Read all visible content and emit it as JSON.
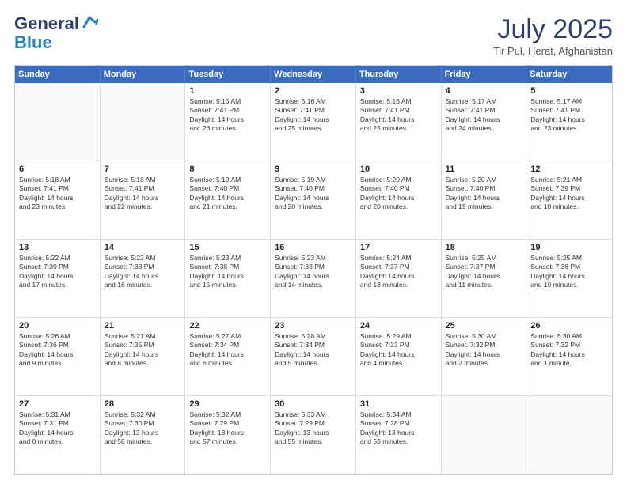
{
  "logo": {
    "general": "General",
    "blue": "Blue"
  },
  "header": {
    "month": "July 2025",
    "location": "Tir Pul, Herat, Afghanistan"
  },
  "days": [
    "Sunday",
    "Monday",
    "Tuesday",
    "Wednesday",
    "Thursday",
    "Friday",
    "Saturday"
  ],
  "weeks": [
    [
      {
        "day": "",
        "lines": []
      },
      {
        "day": "",
        "lines": []
      },
      {
        "day": "1",
        "lines": [
          "Sunrise: 5:15 AM",
          "Sunset: 7:41 PM",
          "Daylight: 14 hours",
          "and 26 minutes."
        ]
      },
      {
        "day": "2",
        "lines": [
          "Sunrise: 5:16 AM",
          "Sunset: 7:41 PM",
          "Daylight: 14 hours",
          "and 25 minutes."
        ]
      },
      {
        "day": "3",
        "lines": [
          "Sunrise: 5:16 AM",
          "Sunset: 7:41 PM",
          "Daylight: 14 hours",
          "and 25 minutes."
        ]
      },
      {
        "day": "4",
        "lines": [
          "Sunrise: 5:17 AM",
          "Sunset: 7:41 PM",
          "Daylight: 14 hours",
          "and 24 minutes."
        ]
      },
      {
        "day": "5",
        "lines": [
          "Sunrise: 5:17 AM",
          "Sunset: 7:41 PM",
          "Daylight: 14 hours",
          "and 23 minutes."
        ]
      }
    ],
    [
      {
        "day": "6",
        "lines": [
          "Sunrise: 5:18 AM",
          "Sunset: 7:41 PM",
          "Daylight: 14 hours",
          "and 23 minutes."
        ]
      },
      {
        "day": "7",
        "lines": [
          "Sunrise: 5:18 AM",
          "Sunset: 7:41 PM",
          "Daylight: 14 hours",
          "and 22 minutes."
        ]
      },
      {
        "day": "8",
        "lines": [
          "Sunrise: 5:19 AM",
          "Sunset: 7:40 PM",
          "Daylight: 14 hours",
          "and 21 minutes."
        ]
      },
      {
        "day": "9",
        "lines": [
          "Sunrise: 5:19 AM",
          "Sunset: 7:40 PM",
          "Daylight: 14 hours",
          "and 20 minutes."
        ]
      },
      {
        "day": "10",
        "lines": [
          "Sunrise: 5:20 AM",
          "Sunset: 7:40 PM",
          "Daylight: 14 hours",
          "and 20 minutes."
        ]
      },
      {
        "day": "11",
        "lines": [
          "Sunrise: 5:20 AM",
          "Sunset: 7:40 PM",
          "Daylight: 14 hours",
          "and 19 minutes."
        ]
      },
      {
        "day": "12",
        "lines": [
          "Sunrise: 5:21 AM",
          "Sunset: 7:39 PM",
          "Daylight: 14 hours",
          "and 18 minutes."
        ]
      }
    ],
    [
      {
        "day": "13",
        "lines": [
          "Sunrise: 5:22 AM",
          "Sunset: 7:39 PM",
          "Daylight: 14 hours",
          "and 17 minutes."
        ]
      },
      {
        "day": "14",
        "lines": [
          "Sunrise: 5:22 AM",
          "Sunset: 7:38 PM",
          "Daylight: 14 hours",
          "and 16 minutes."
        ]
      },
      {
        "day": "15",
        "lines": [
          "Sunrise: 5:23 AM",
          "Sunset: 7:38 PM",
          "Daylight: 14 hours",
          "and 15 minutes."
        ]
      },
      {
        "day": "16",
        "lines": [
          "Sunrise: 5:23 AM",
          "Sunset: 7:38 PM",
          "Daylight: 14 hours",
          "and 14 minutes."
        ]
      },
      {
        "day": "17",
        "lines": [
          "Sunrise: 5:24 AM",
          "Sunset: 7:37 PM",
          "Daylight: 14 hours",
          "and 13 minutes."
        ]
      },
      {
        "day": "18",
        "lines": [
          "Sunrise: 5:25 AM",
          "Sunset: 7:37 PM",
          "Daylight: 14 hours",
          "and 11 minutes."
        ]
      },
      {
        "day": "19",
        "lines": [
          "Sunrise: 5:25 AM",
          "Sunset: 7:36 PM",
          "Daylight: 14 hours",
          "and 10 minutes."
        ]
      }
    ],
    [
      {
        "day": "20",
        "lines": [
          "Sunrise: 5:26 AM",
          "Sunset: 7:36 PM",
          "Daylight: 14 hours",
          "and 9 minutes."
        ]
      },
      {
        "day": "21",
        "lines": [
          "Sunrise: 5:27 AM",
          "Sunset: 7:35 PM",
          "Daylight: 14 hours",
          "and 8 minutes."
        ]
      },
      {
        "day": "22",
        "lines": [
          "Sunrise: 5:27 AM",
          "Sunset: 7:34 PM",
          "Daylight: 14 hours",
          "and 6 minutes."
        ]
      },
      {
        "day": "23",
        "lines": [
          "Sunrise: 5:28 AM",
          "Sunset: 7:34 PM",
          "Daylight: 14 hours",
          "and 5 minutes."
        ]
      },
      {
        "day": "24",
        "lines": [
          "Sunrise: 5:29 AM",
          "Sunset: 7:33 PM",
          "Daylight: 14 hours",
          "and 4 minutes."
        ]
      },
      {
        "day": "25",
        "lines": [
          "Sunrise: 5:30 AM",
          "Sunset: 7:32 PM",
          "Daylight: 14 hours",
          "and 2 minutes."
        ]
      },
      {
        "day": "26",
        "lines": [
          "Sunrise: 5:30 AM",
          "Sunset: 7:32 PM",
          "Daylight: 14 hours",
          "and 1 minute."
        ]
      }
    ],
    [
      {
        "day": "27",
        "lines": [
          "Sunrise: 5:31 AM",
          "Sunset: 7:31 PM",
          "Daylight: 14 hours",
          "and 0 minutes."
        ]
      },
      {
        "day": "28",
        "lines": [
          "Sunrise: 5:32 AM",
          "Sunset: 7:30 PM",
          "Daylight: 13 hours",
          "and 58 minutes."
        ]
      },
      {
        "day": "29",
        "lines": [
          "Sunrise: 5:32 AM",
          "Sunset: 7:29 PM",
          "Daylight: 13 hours",
          "and 57 minutes."
        ]
      },
      {
        "day": "30",
        "lines": [
          "Sunrise: 5:33 AM",
          "Sunset: 7:29 PM",
          "Daylight: 13 hours",
          "and 55 minutes."
        ]
      },
      {
        "day": "31",
        "lines": [
          "Sunrise: 5:34 AM",
          "Sunset: 7:28 PM",
          "Daylight: 13 hours",
          "and 53 minutes."
        ]
      },
      {
        "day": "",
        "lines": []
      },
      {
        "day": "",
        "lines": []
      }
    ]
  ]
}
